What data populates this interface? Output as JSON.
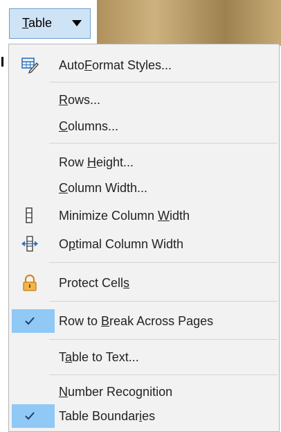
{
  "button": {
    "label_pre": "",
    "label_u": "T",
    "label_post": "able"
  },
  "menu": {
    "autoformat": {
      "pre": "Auto",
      "u": "F",
      "post": "ormat Styles..."
    },
    "rows": {
      "pre": "",
      "u": "R",
      "post": "ows..."
    },
    "columns": {
      "pre": "",
      "u": "C",
      "post": "olumns..."
    },
    "row_height": {
      "pre": "Row ",
      "u": "H",
      "post": "eight..."
    },
    "column_width": {
      "pre": "",
      "u": "C",
      "post": "olumn Width..."
    },
    "minimize_column_width": {
      "pre": "Minimize Column ",
      "u": "W",
      "post": "idth"
    },
    "optimal_column_width": {
      "pre": "O",
      "u": "p",
      "post": "timal Column Width"
    },
    "protect_cells": {
      "pre": "Protect Cell",
      "u": "s",
      "post": ""
    },
    "row_break": {
      "pre": "Row to ",
      "u": "B",
      "post": "reak Across Pages",
      "checked": true
    },
    "table_to_text": {
      "pre": "T",
      "u": "a",
      "post": "ble to Text..."
    },
    "number_recognition": {
      "pre": "",
      "u": "N",
      "post": "umber Recognition"
    },
    "table_boundaries": {
      "pre": "Table Boundar",
      "u": "i",
      "post": "es",
      "checked": true
    }
  },
  "colors": {
    "highlight": "#90c8f6",
    "button_bg": "#cfe3f7",
    "button_border": "#6e9ed0",
    "menu_bg": "#f2f2f2"
  },
  "icons": [
    "autoformat-icon",
    "minimize-column-width-icon",
    "optimal-column-width-icon",
    "lock-icon",
    "checkmark-icon"
  ]
}
